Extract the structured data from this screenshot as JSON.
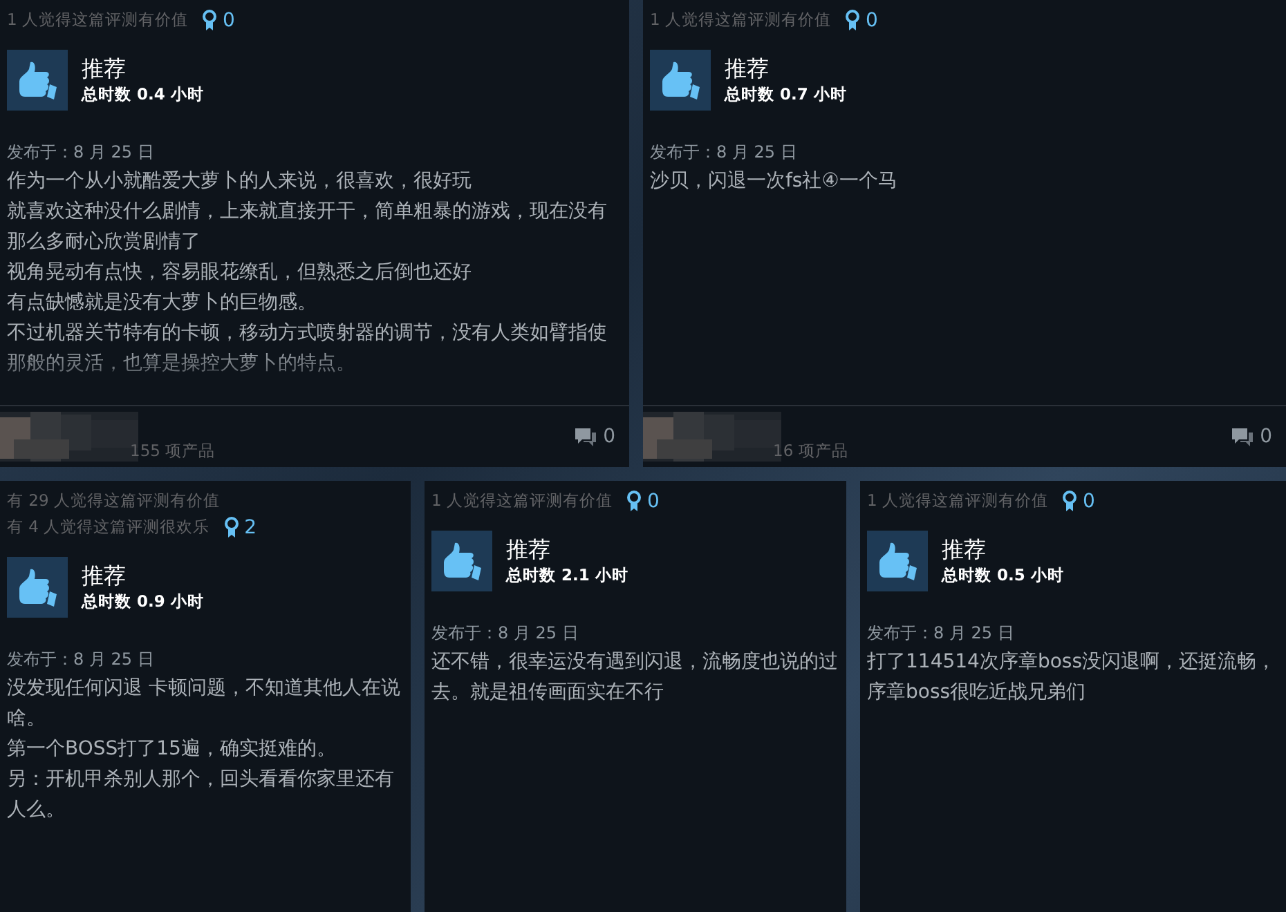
{
  "rows": [
    {
      "reviews": [
        {
          "helpful": [
            "1 人觉得这篇评测有价值"
          ],
          "awards": "0",
          "verdict": "推荐",
          "hours": "总时数 0.4 小时",
          "posted": "发布于：8 月 25 日",
          "body": [
            "作为一个从小就酷爱大萝卜的人来说，很喜欢，很好玩",
            "就喜欢这种没什么剧情，上来就直接开干，简单粗暴的游戏，现在没有那么多耐心欣赏剧情了",
            "视角晃动有点快，容易眼花缭乱，但熟悉之后倒也还好",
            "有点缺憾就是没有大萝卜的巨物感。",
            "不过机器关节特有的卡顿，移动方式喷射器的调节，没有人类如臂指使那般的灵活，也算是操控大萝卜的特点。"
          ],
          "truncated": true,
          "footer": {
            "products": "155 项产品",
            "comments": "0"
          }
        },
        {
          "helpful": [
            "1 人觉得这篇评测有价值"
          ],
          "awards": "0",
          "verdict": "推荐",
          "hours": "总时数 0.7 小时",
          "posted": "发布于：8 月 25 日",
          "body": [
            "沙贝，闪退一次fs社④一个马"
          ],
          "footer": {
            "products": "16 项产品",
            "comments": "0"
          }
        }
      ]
    },
    {
      "reviews": [
        {
          "helpful": [
            "有 29 人觉得这篇评测有价值",
            "有 4 人觉得这篇评测很欢乐"
          ],
          "awards": "2",
          "verdict": "推荐",
          "hours": "总时数 0.9 小时",
          "posted": "发布于：8 月 25 日",
          "body": [
            "没发现任何闪退 卡顿问题，不知道其他人在说啥。",
            "第一个BOSS打了15遍，确实挺难的。",
            "另：开机甲杀别人那个，回头看看你家里还有人么。"
          ]
        },
        {
          "helpful": [
            "1 人觉得这篇评测有价值"
          ],
          "awards": "0",
          "verdict": "推荐",
          "hours": "总时数 2.1 小时",
          "posted": "发布于：8 月 25 日",
          "body": [
            "还不错，很幸运没有遇到闪退，流畅度也说的过去。就是祖传画面实在不行"
          ]
        },
        {
          "helpful": [
            "1 人觉得这篇评测有价值"
          ],
          "awards": "0",
          "verdict": "推荐",
          "hours": "总时数 0.5 小时",
          "posted": "发布于：8 月 25 日",
          "body": [
            "打了114514次序章boss没闪退啊，还挺流畅，序章boss很吃近战兄弟们"
          ]
        }
      ]
    }
  ]
}
